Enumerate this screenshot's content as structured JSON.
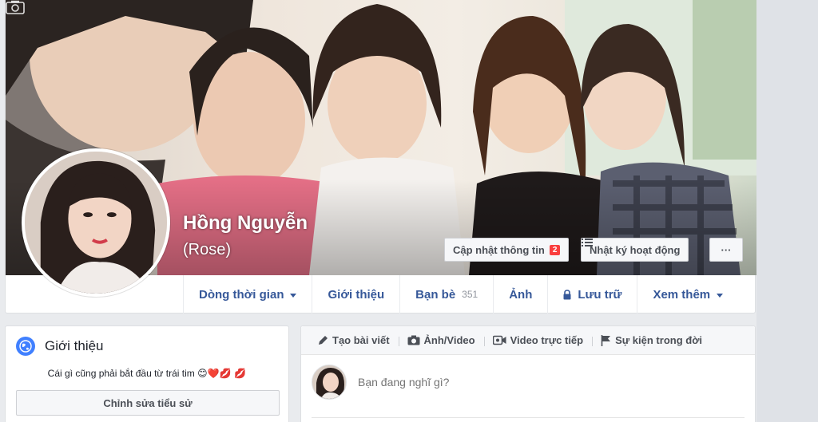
{
  "profile": {
    "name": "Hồng Nguyễn",
    "alternate_name": "(Rose)"
  },
  "cover_buttons": {
    "update_info_label": "Cập nhật thông tin",
    "update_info_badge": "2",
    "activity_log_label": "Nhật ký hoạt động",
    "more_label": "···"
  },
  "tabs": [
    {
      "label": "Dòng thời gian",
      "icon": "caret-down-icon"
    },
    {
      "label": "Giới thiệu"
    },
    {
      "label": "Bạn bè",
      "count": "351"
    },
    {
      "label": "Ảnh"
    },
    {
      "label": "Lưu trữ",
      "icon": "lock-icon"
    },
    {
      "label": "Xem thêm",
      "icon": "caret-down-icon"
    }
  ],
  "intro": {
    "title": "Giới thiệu",
    "bio": "Cái gì cũng phải bắt đầu từ trái tim",
    "bio_emojis": "😊❤️💋 💋",
    "edit_bio_label": "Chỉnh sửa tiểu sử"
  },
  "composer": {
    "tabs": [
      {
        "label": "Tạo bài viết",
        "icon": "pencil-icon"
      },
      {
        "label": "Ảnh/Video",
        "icon": "camera-icon"
      },
      {
        "label": "Video trực tiếp",
        "icon": "video-camera-icon"
      },
      {
        "label": "Sự kiện trong đời",
        "icon": "flag-icon"
      }
    ],
    "placeholder": "Bạn đang nghĩ gì?"
  },
  "colors": {
    "link_blue": "#365899",
    "badge_red": "#fa3e3e",
    "page_bg": "#e9ebee",
    "globe_blue": "#4080ff"
  }
}
